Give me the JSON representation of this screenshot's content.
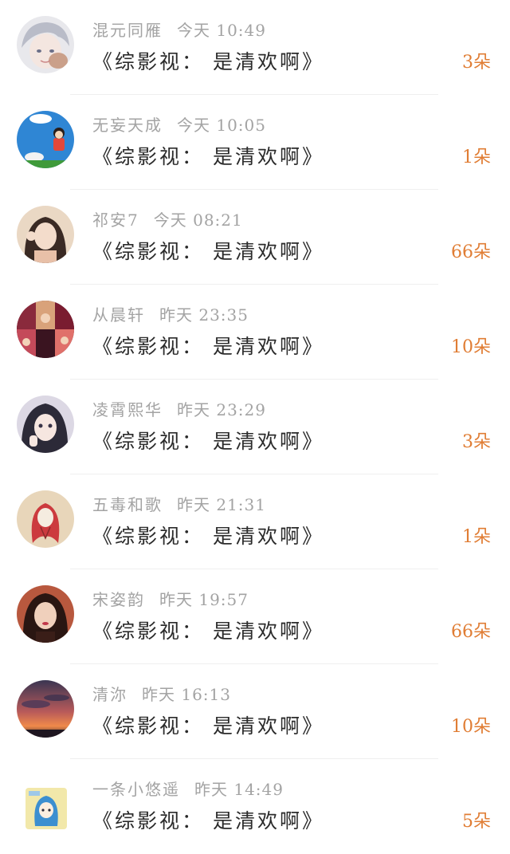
{
  "book_title": "《综影视：  是清欢啊》",
  "items": [
    {
      "name": "混元同雁",
      "time": "今天 10:49",
      "count": "3朵",
      "avatar_icon": "avatar-anime-boy",
      "avatar_colors": [
        "#d9dbe4",
        "#b9a8a8"
      ]
    },
    {
      "name": "无妄天成",
      "time": "今天 10:05",
      "count": "1朵",
      "avatar_icon": "avatar-cartoon-sky",
      "avatar_colors": [
        "#2e86d6",
        "#e34b3a"
      ]
    },
    {
      "name": "祁安7",
      "time": "今天 08:21",
      "count": "66朵",
      "avatar_icon": "avatar-girl-photo",
      "avatar_colors": [
        "#e8c8a8",
        "#3a2a24"
      ]
    },
    {
      "name": "从晨轩",
      "time": "昨天 23:35",
      "count": "10朵",
      "avatar_icon": "avatar-collage",
      "avatar_colors": [
        "#6a1e2a",
        "#d94c6a"
      ]
    },
    {
      "name": "凌霄熙华",
      "time": "昨天 23:29",
      "count": "3朵",
      "avatar_icon": "avatar-girl-selfie",
      "avatar_colors": [
        "#d8d4e0",
        "#2a2a38"
      ]
    },
    {
      "name": "五毒和歌",
      "time": "昨天 21:31",
      "count": "1朵",
      "avatar_icon": "avatar-red-hair-drawing",
      "avatar_colors": [
        "#e6d2b4",
        "#c9343a"
      ]
    },
    {
      "name": "宋姿韵",
      "time": "昨天 19:57",
      "count": "66朵",
      "avatar_icon": "avatar-woman-portrait",
      "avatar_colors": [
        "#c2644a",
        "#2a1612"
      ]
    },
    {
      "name": "清沵",
      "time": "昨天 16:13",
      "count": "10朵",
      "avatar_icon": "avatar-sunset-sky",
      "avatar_colors": [
        "#3a3552",
        "#e0704a"
      ]
    },
    {
      "name": "一条小悠遥",
      "time": "昨天 14:49",
      "count": "5朵",
      "avatar_icon": "avatar-chibi-blue",
      "avatar_colors": [
        "#f2e8a8",
        "#3c8fd0"
      ]
    }
  ]
}
